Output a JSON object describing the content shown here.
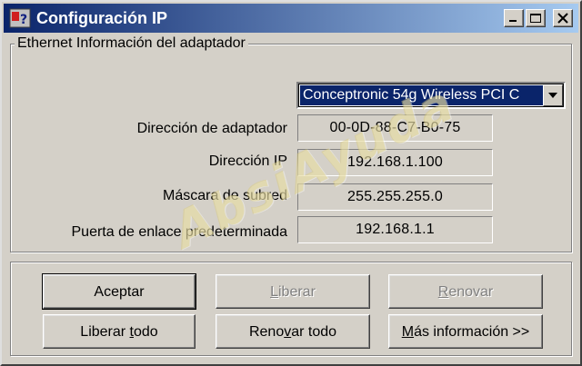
{
  "window": {
    "title": "Configuración IP",
    "colors": {
      "titlebar_start": "#0a246a",
      "titlebar_end": "#a6caf0",
      "face": "#d4d0c8",
      "selection": "#0a246a"
    }
  },
  "titlebar_buttons": {
    "minimize_icon": "minimize-icon",
    "maximize_icon": "maximize-icon",
    "close_icon": "close-icon"
  },
  "adapter_group": {
    "legend": "Ethernet  Información del adaptador",
    "adapter_select": {
      "value": "Conceptronic 54g Wireless PCI C",
      "icon": "chevron-down-icon"
    },
    "fields": [
      {
        "label": "Dirección de adaptador",
        "value": "00-0D-88-C7-B0-75"
      },
      {
        "label": "Dirección IP",
        "value": "192.168.1.100"
      },
      {
        "label": "Máscara de subred",
        "value": "255.255.255.0"
      },
      {
        "label": "Puerta de enlace predeterminada",
        "value": "192.168.1.1"
      }
    ]
  },
  "buttons": {
    "accept": {
      "pre": "",
      "mnemonic": "",
      "post": "Aceptar"
    },
    "release": {
      "pre": "",
      "mnemonic": "L",
      "post": "iberar"
    },
    "renew": {
      "pre": "",
      "mnemonic": "R",
      "post": "enovar"
    },
    "release_all": {
      "pre": "Liberar ",
      "mnemonic": "t",
      "post": "odo"
    },
    "renew_all": {
      "pre": "Reno",
      "mnemonic": "v",
      "post": "ar todo"
    },
    "more_info": {
      "pre": "",
      "mnemonic": "M",
      "post": "ás información >>"
    }
  },
  "watermark": {
    "text": "AbsiAyuda"
  }
}
